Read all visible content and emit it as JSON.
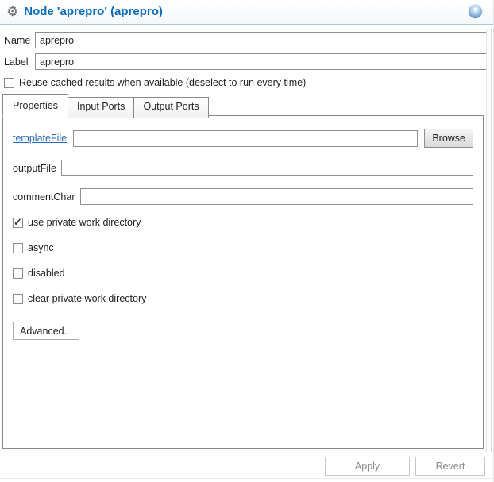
{
  "header": {
    "title": "Node 'aprepro' (aprepro)"
  },
  "fields": {
    "name": {
      "label": "Name",
      "value": "aprepro"
    },
    "label_field": {
      "label": "Label",
      "value": "aprepro"
    }
  },
  "reuse": {
    "label": "Reuse cached results when available (deselect to run every time)",
    "checked": false
  },
  "tabs": [
    {
      "label": "Properties",
      "active": true
    },
    {
      "label": "Input Ports",
      "active": false
    },
    {
      "label": "Output Ports",
      "active": false
    }
  ],
  "props": {
    "template_file": {
      "label": "templateFile",
      "value": "",
      "browse_label": "Browse"
    },
    "output_file": {
      "label": "outputFile",
      "value": ""
    },
    "comment_char": {
      "label": "commentChar",
      "value": ""
    },
    "checkboxes": [
      {
        "label": "use private work directory",
        "checked": true
      },
      {
        "label": "async",
        "checked": false
      },
      {
        "label": "disabled",
        "checked": false
      },
      {
        "label": "clear private work directory",
        "checked": false
      }
    ],
    "advanced_label": "Advanced..."
  },
  "footer": {
    "apply_label": "Apply",
    "revert_label": "Revert"
  },
  "icons": {
    "gear": "gear-icon",
    "help": "help-icon",
    "checkmark": "check-icon"
  },
  "colors": {
    "title_blue": "#0d6ab8",
    "link_blue": "#2a67b8",
    "header_divider": "#aac4dc",
    "border_gray": "#8a8a8a",
    "disabled_button_text": "#8b8b8b"
  }
}
